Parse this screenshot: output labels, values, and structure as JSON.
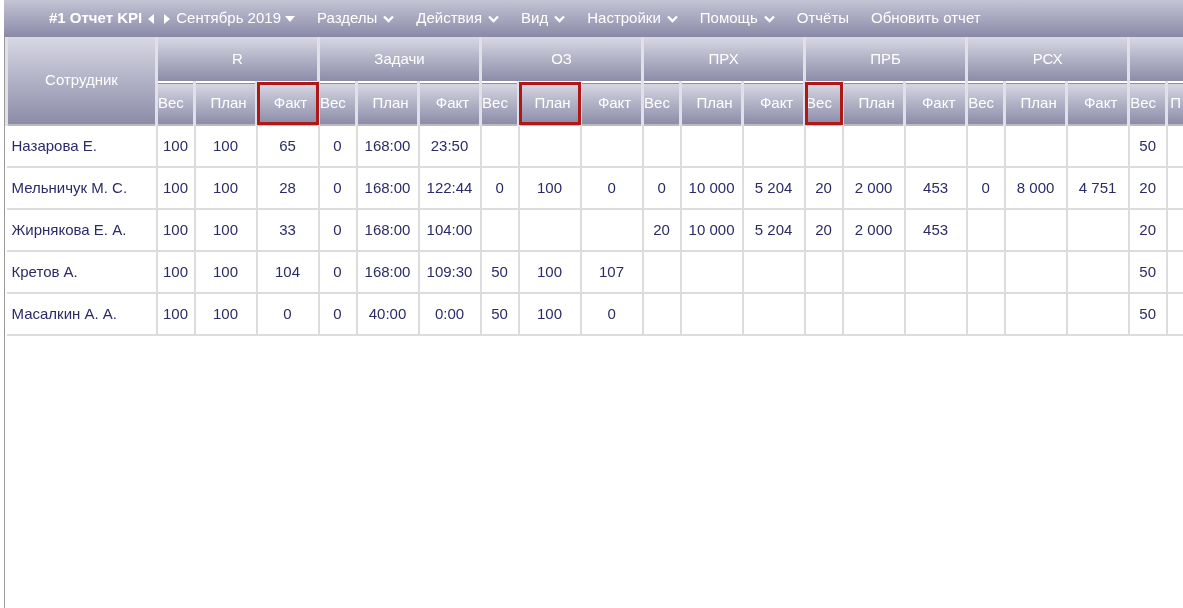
{
  "toolbar": {
    "title": "#1 Отчет KPI",
    "period": "Сентябрь 2019",
    "menus": [
      {
        "label": "Разделы",
        "has_menu": true
      },
      {
        "label": "Действия",
        "has_menu": true
      },
      {
        "label": "Вид",
        "has_menu": true
      },
      {
        "label": "Настройки",
        "has_menu": true
      },
      {
        "label": "Помощь",
        "has_menu": true
      },
      {
        "label": "Отчёты",
        "has_menu": false
      },
      {
        "label": "Обновить отчет",
        "has_menu": false
      }
    ]
  },
  "table": {
    "name_column": "Сотрудник",
    "groups": [
      {
        "title": "R",
        "columns": [
          {
            "label": "Вес",
            "highlighted": false
          },
          {
            "label": "План",
            "highlighted": false
          },
          {
            "label": "Факт",
            "highlighted": true
          }
        ]
      },
      {
        "title": "Задачи",
        "columns": [
          {
            "label": "Вес",
            "highlighted": false
          },
          {
            "label": "План",
            "highlighted": false
          },
          {
            "label": "Факт",
            "highlighted": false
          }
        ]
      },
      {
        "title": "ОЗ",
        "columns": [
          {
            "label": "Вес",
            "highlighted": false
          },
          {
            "label": "План",
            "highlighted": true
          },
          {
            "label": "Факт",
            "highlighted": false
          }
        ]
      },
      {
        "title": "ПРХ",
        "columns": [
          {
            "label": "Вес",
            "highlighted": false
          },
          {
            "label": "План",
            "highlighted": false
          },
          {
            "label": "Факт",
            "highlighted": false
          }
        ]
      },
      {
        "title": "ПРБ",
        "columns": [
          {
            "label": "Вес",
            "highlighted": true
          },
          {
            "label": "План",
            "highlighted": false
          },
          {
            "label": "Факт",
            "highlighted": false
          }
        ]
      },
      {
        "title": "РСХ",
        "columns": [
          {
            "label": "Вес",
            "highlighted": false
          },
          {
            "label": "План",
            "highlighted": false
          },
          {
            "label": "Факт",
            "highlighted": false
          }
        ]
      },
      {
        "columns": [
          {
            "label": "Вес",
            "highlighted": false
          },
          {
            "label": "П",
            "highlighted": false
          }
        ]
      }
    ],
    "rows": [
      {
        "name": "Назарова Е.",
        "cells": [
          "100",
          "100",
          "65",
          "0",
          "168:00",
          "23:50",
          null,
          null,
          null,
          null,
          null,
          null,
          null,
          null,
          null,
          null,
          null,
          null,
          "50",
          null
        ]
      },
      {
        "name": "Мельничук М. С.",
        "cells": [
          "100",
          "100",
          "28",
          "0",
          "168:00",
          "122:44",
          "0",
          "100",
          "0",
          "0",
          "10 000",
          "5 204",
          "20",
          "2 000",
          "453",
          "0",
          "8 000",
          "4 751",
          "20",
          null
        ]
      },
      {
        "name": "Жирнякова Е. А.",
        "cells": [
          "100",
          "100",
          "33",
          "0",
          "168:00",
          "104:00",
          null,
          null,
          null,
          "20",
          "10 000",
          "5 204",
          "20",
          "2 000",
          "453",
          null,
          null,
          null,
          "20",
          null
        ]
      },
      {
        "name": "Кретов А.",
        "cells": [
          "100",
          "100",
          "104",
          "0",
          "168:00",
          "109:30",
          "50",
          "100",
          "107",
          null,
          null,
          null,
          null,
          null,
          null,
          null,
          null,
          null,
          "50",
          null
        ]
      },
      {
        "name": "Масалкин А. А.",
        "cells": [
          "100",
          "100",
          "0",
          "0",
          "40:00",
          "0:00",
          "50",
          "100",
          "0",
          null,
          null,
          null,
          null,
          null,
          null,
          null,
          null,
          null,
          "50",
          null
        ]
      }
    ]
  }
}
